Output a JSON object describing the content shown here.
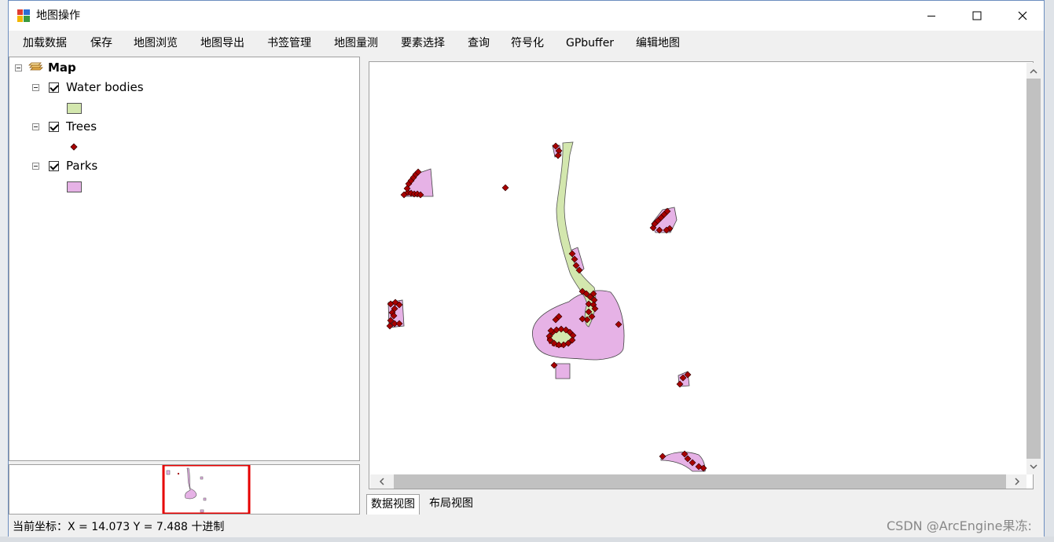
{
  "window": {
    "title": "地图操作",
    "minimize_glyph": "–",
    "maximize_glyph": "☐",
    "close_glyph": "✕"
  },
  "menu": {
    "items": [
      "加载数据",
      "保存",
      "地图浏览",
      "地图导出",
      "书签管理",
      "地图量测",
      "要素选择",
      "查询",
      "符号化",
      "GPbuffer",
      "编辑地图"
    ]
  },
  "toc": {
    "root_label": "Map",
    "layers": [
      {
        "label": "Water bodies",
        "symbol": "polygon",
        "color": "#d3e7ae"
      },
      {
        "label": "Trees",
        "symbol": "point",
        "color": "#a80000"
      },
      {
        "label": "Parks",
        "symbol": "polygon",
        "color": "#e6b2e6"
      }
    ]
  },
  "tabs": {
    "data_view": "数据视图",
    "layout_view": "布局视图"
  },
  "status": {
    "coords": "当前坐标：X = 14.073 Y = 7.488 十进制"
  },
  "watermark": "CSDN @ArcEngine果冻:",
  "colors": {
    "park_fill": "#e6b2e6",
    "water_fill": "#d3e7ae",
    "tree_fill": "#a80000",
    "overview_extent": "#e60000"
  },
  "icons": {
    "app": "map-app-icon",
    "layers": "layers-icon",
    "scroll_up": "chevron-up-icon",
    "scroll_down": "chevron-down-icon",
    "scroll_left": "chevron-left-icon",
    "scroll_right": "chevron-right-icon"
  }
}
